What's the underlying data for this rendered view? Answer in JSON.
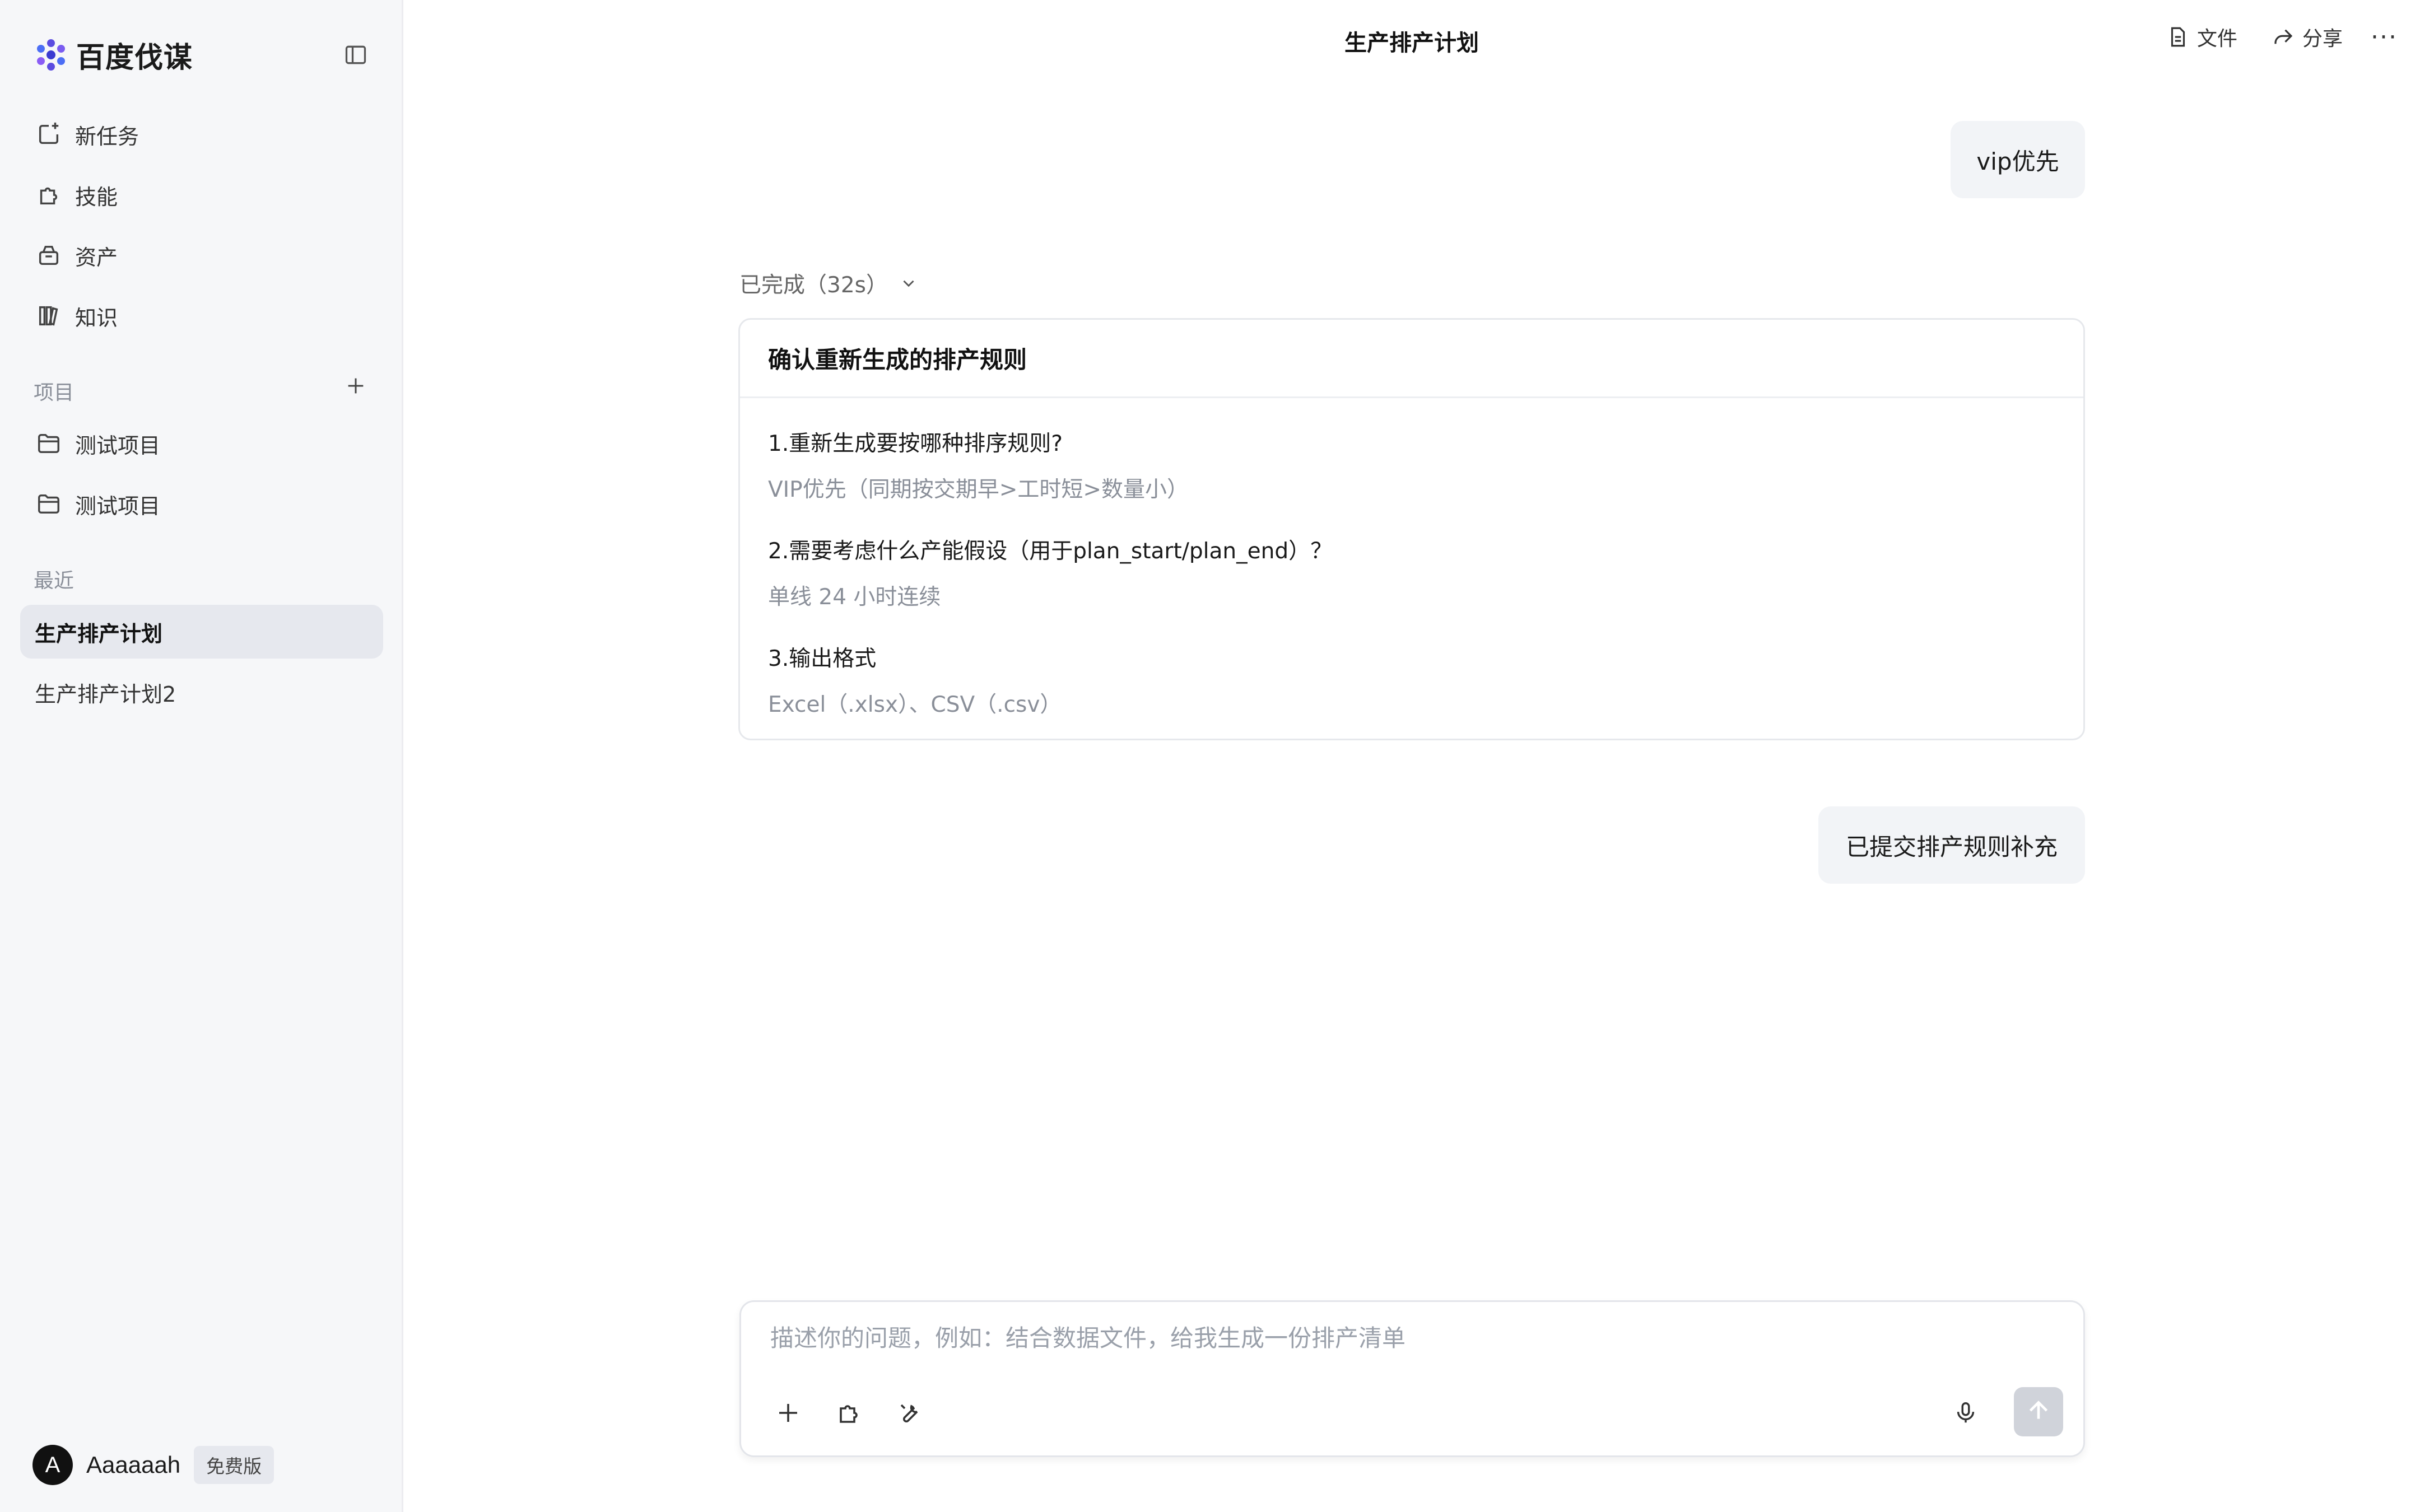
{
  "app": {
    "name": "百度伐谋"
  },
  "sidebar": {
    "nav": [
      {
        "label": "新任务",
        "icon": "new-task-icon"
      },
      {
        "label": "技能",
        "icon": "puzzle-icon"
      },
      {
        "label": "资产",
        "icon": "box-icon"
      },
      {
        "label": "知识",
        "icon": "library-icon"
      }
    ],
    "projects_label": "项目",
    "projects": [
      {
        "label": "测试项目",
        "icon": "folder-icon"
      },
      {
        "label": "测试项目",
        "icon": "folder-icon"
      }
    ],
    "recent_label": "最近",
    "recent": [
      {
        "label": "生产排产计划",
        "active": true
      },
      {
        "label": "生产排产计划2",
        "active": false
      }
    ],
    "user": {
      "initial": "A",
      "name": "Aaaaaah",
      "plan": "免费版"
    }
  },
  "header": {
    "title": "生产排产计划",
    "file_label": "文件",
    "share_label": "分享",
    "more": "···"
  },
  "chat": {
    "user_msg_1": "vip优先",
    "status": "已完成（32s）",
    "card": {
      "title": "确认重新生成的排产规则",
      "items": [
        {
          "q": "1.重新生成要按哪种排序规则?",
          "a": "VIP优先（同期按交期早>工时短>数量小）"
        },
        {
          "q": "2.需要考虑什么产能假设（用于plan_start/plan_end）？",
          "a": "单线 24 小时连续"
        },
        {
          "q": "3.输出格式",
          "a": "Excel（.xlsx）、CSV（.csv）"
        }
      ]
    },
    "user_msg_2": "已提交排产规则补充"
  },
  "composer": {
    "placeholder": "描述你的问题，例如：结合数据文件，给我生成一份排产清单",
    "value": ""
  },
  "colors": {
    "accent": "#5b4ce0",
    "sidebar_bg": "#f6f7f9",
    "bubble_bg": "#f2f4f7"
  }
}
